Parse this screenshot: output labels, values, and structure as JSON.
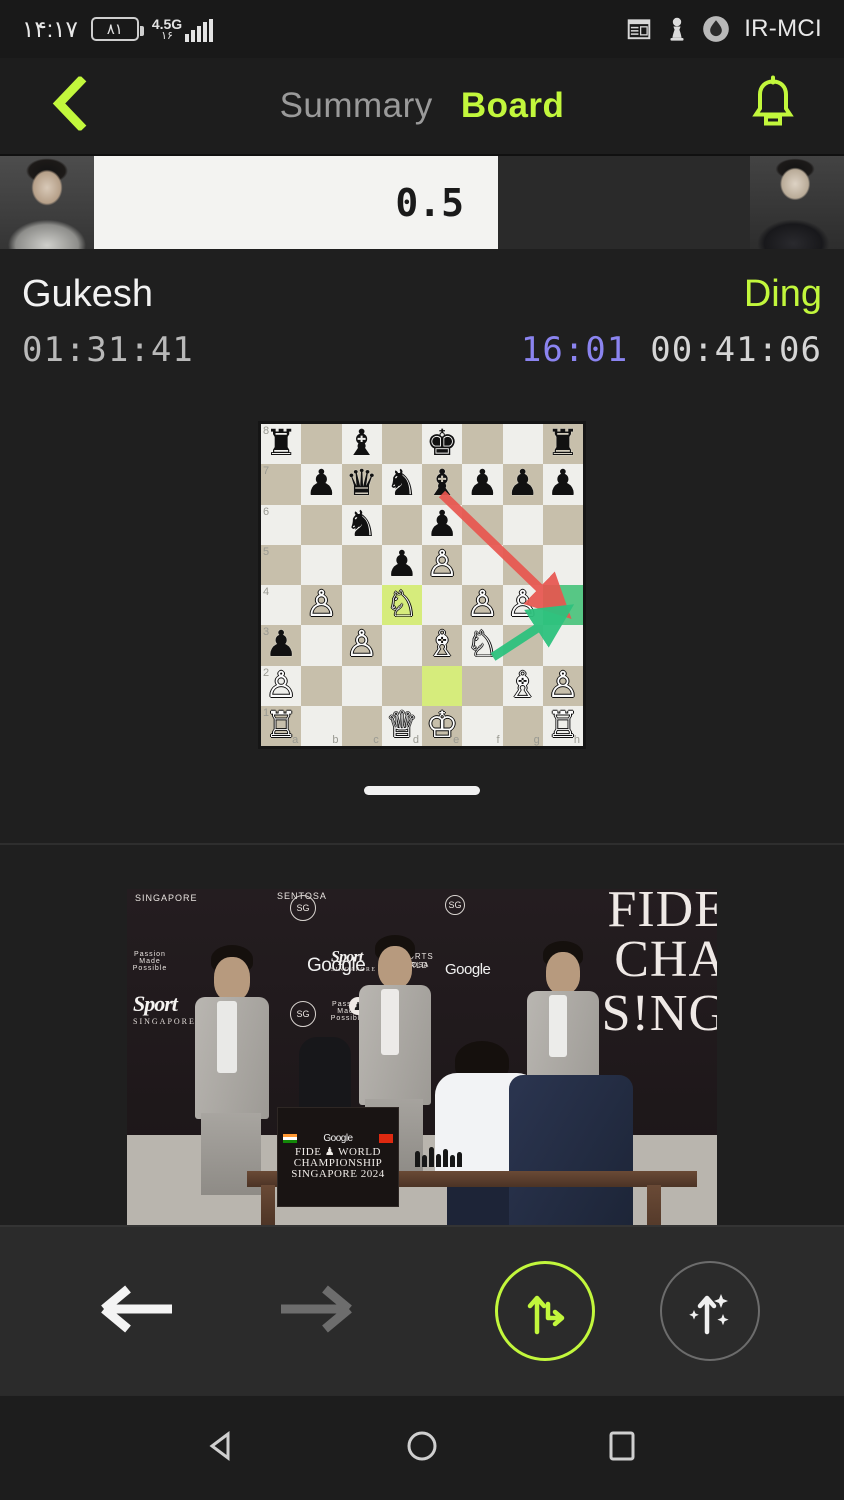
{
  "status_bar": {
    "time": "۱۴:۱۷",
    "battery_level": "۸۱",
    "network_type": "4.5G",
    "network_sub": "۱۶",
    "carrier": "IR-MCI",
    "icons": [
      "calendar-icon",
      "chess-pawn-icon",
      "water-drop-icon"
    ]
  },
  "top_nav": {
    "back_icon": "chevron-left-icon",
    "tabs": [
      {
        "label": "Summary",
        "active": false
      },
      {
        "label": "Board",
        "active": true
      }
    ],
    "bell_icon": "bell-icon"
  },
  "evaluation": {
    "score": "0.5",
    "white_percent": 59,
    "white_color": "#f3f3f1",
    "black_color": "#2a2a2a"
  },
  "players": {
    "white": {
      "name": "Gukesh",
      "clock": "01:31:41",
      "active": false
    },
    "black": {
      "name": "Ding",
      "clock": "00:41:06",
      "active": true
    },
    "move_time": "16:01",
    "accent_color": "#c2f73c",
    "move_time_color": "#8b84f0"
  },
  "board": {
    "light_square": "#efefeb",
    "dark_square": "#c7bfab",
    "highlight_color": "#d6ec7c",
    "target_color": "#57c785",
    "orientation": "white",
    "rank_labels": [
      "8",
      "7",
      "6",
      "5",
      "4",
      "3",
      "2",
      "1"
    ],
    "file_labels": [
      "a",
      "b",
      "c",
      "d",
      "e",
      "f",
      "g",
      "h"
    ],
    "highlighted_squares": [
      "d4",
      "e2"
    ],
    "target_square": "h4",
    "arrows": [
      {
        "from": "e7",
        "to": "h4",
        "color": "#e8564f",
        "name": "threat-arrow"
      },
      {
        "from": "f3",
        "to": "h4",
        "color": "#2ec27e",
        "name": "best-move-arrow"
      }
    ],
    "pieces": [
      {
        "sq": "a8",
        "glyph": "♜",
        "side": "b"
      },
      {
        "sq": "c8",
        "glyph": "♝",
        "side": "b"
      },
      {
        "sq": "e8",
        "glyph": "♚",
        "side": "b"
      },
      {
        "sq": "h8",
        "glyph": "♜",
        "side": "b"
      },
      {
        "sq": "b7",
        "glyph": "♟",
        "side": "b"
      },
      {
        "sq": "c7",
        "glyph": "♛",
        "side": "b"
      },
      {
        "sq": "d7",
        "glyph": "♞",
        "side": "b"
      },
      {
        "sq": "e7",
        "glyph": "♝",
        "side": "b"
      },
      {
        "sq": "f7",
        "glyph": "♟",
        "side": "b"
      },
      {
        "sq": "g7",
        "glyph": "♟",
        "side": "b"
      },
      {
        "sq": "h7",
        "glyph": "♟",
        "side": "b"
      },
      {
        "sq": "c6",
        "glyph": "♞",
        "side": "b"
      },
      {
        "sq": "e6",
        "glyph": "♟",
        "side": "b"
      },
      {
        "sq": "d5",
        "glyph": "♟",
        "side": "b"
      },
      {
        "sq": "e5",
        "glyph": "♙",
        "side": "w"
      },
      {
        "sq": "b4",
        "glyph": "♙",
        "side": "w"
      },
      {
        "sq": "d4",
        "glyph": "♘",
        "side": "w"
      },
      {
        "sq": "f4",
        "glyph": "♙",
        "side": "w"
      },
      {
        "sq": "g4",
        "glyph": "♙",
        "side": "w"
      },
      {
        "sq": "a3",
        "glyph": "♟",
        "side": "b"
      },
      {
        "sq": "c3",
        "glyph": "♙",
        "side": "w"
      },
      {
        "sq": "e3",
        "glyph": "♗",
        "side": "w"
      },
      {
        "sq": "f3",
        "glyph": "♘",
        "side": "w"
      },
      {
        "sq": "a2",
        "glyph": "♙",
        "side": "w"
      },
      {
        "sq": "g2",
        "glyph": "♗",
        "side": "w"
      },
      {
        "sq": "h2",
        "glyph": "♙",
        "side": "w"
      },
      {
        "sq": "a1",
        "glyph": "♖",
        "side": "w"
      },
      {
        "sq": "d1",
        "glyph": "♕",
        "side": "w"
      },
      {
        "sq": "e1",
        "glyph": "♔",
        "side": "w"
      },
      {
        "sq": "h1",
        "glyph": "♖",
        "side": "w"
      }
    ]
  },
  "photo": {
    "headline_lines": [
      "FIDE",
      "CHA",
      "S!NG"
    ],
    "sign_lines": [
      "FIDE ♟ WORLD",
      "CHAMPIONSHIP",
      "SINGAPORE 2024"
    ],
    "sponsors": {
      "google": "Google",
      "sport_brand": "Sport",
      "sport_sub": "SINGAPORE",
      "resorts": "RESORTS WORLD",
      "resorts_sub": "SENTOSA",
      "sg_badge": "SG",
      "passion_text": "Passion Made Possible"
    }
  },
  "toolbar": {
    "prev_label": "previous-move",
    "next_label": "next-move",
    "analyze_label": "branch-move",
    "magic_label": "engine-suggest",
    "prev_enabled": true,
    "next_enabled": false,
    "accent_color": "#c2f73c"
  },
  "android_nav": {
    "back": "back-triangle-icon",
    "home": "home-circle-icon",
    "recents": "recents-square-icon"
  }
}
